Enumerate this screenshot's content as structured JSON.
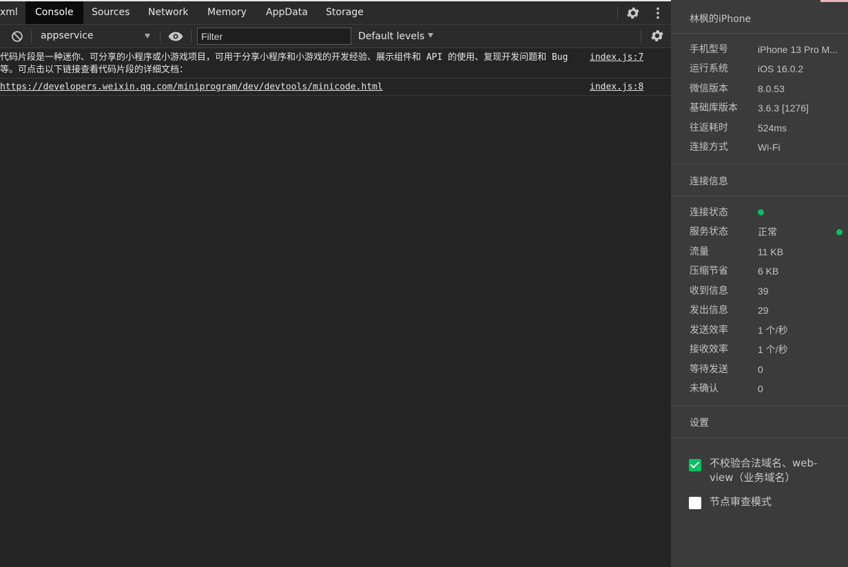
{
  "tabs": [
    {
      "label": "xml",
      "active": false
    },
    {
      "label": "Console",
      "active": true
    },
    {
      "label": "Sources",
      "active": false
    },
    {
      "label": "Network",
      "active": false
    },
    {
      "label": "Memory",
      "active": false
    },
    {
      "label": "AppData",
      "active": false
    },
    {
      "label": "Storage",
      "active": false
    }
  ],
  "toolbar": {
    "context": "appservice",
    "filter_placeholder": "Filter",
    "levels": "Default levels"
  },
  "console": {
    "messages": [
      {
        "text": "代码片段是一种迷你、可分享的小程序或小游戏项目，可用于分享小程序和小游戏的开发经验、展示组件和 API 的使用、复现开发问题和 Bug 等。可点击以下链接查看代码片段的详细文档：",
        "source": "index.js:7"
      },
      {
        "text": "https://developers.weixin.qq.com/miniprogram/dev/devtools/minicode.html",
        "source": "index.js:8"
      }
    ]
  },
  "device": {
    "title": "林枫的iPhone",
    "info": [
      {
        "key": "手机型号",
        "value": "iPhone 13 Pro M..."
      },
      {
        "key": "运行系统",
        "value": "iOS 16.0.2"
      },
      {
        "key": "微信版本",
        "value": "8.0.53"
      },
      {
        "key": "基础库版本",
        "value": "3.6.3 [1276]"
      },
      {
        "key": "往返耗时",
        "value": "524ms"
      },
      {
        "key": "连接方式",
        "value": "Wi-Fi"
      }
    ]
  },
  "connection": {
    "title": "连接信息",
    "rows": [
      {
        "key": "连接状态",
        "value": ""
      },
      {
        "key": "服务状态",
        "value": "正常"
      },
      {
        "key": "流量",
        "value": "11 KB"
      },
      {
        "key": "压缩节省",
        "value": "6 KB"
      },
      {
        "key": "收到信息",
        "value": "39"
      },
      {
        "key": "发出信息",
        "value": "29"
      },
      {
        "key": "发送效率",
        "value": "1 个/秒"
      },
      {
        "key": "接收效率",
        "value": "1 个/秒"
      },
      {
        "key": "等待发送",
        "value": "0"
      },
      {
        "key": "未确认",
        "value": "0"
      }
    ],
    "status_color": "#07c160"
  },
  "settings": {
    "title": "设置",
    "options": [
      {
        "label": "不校验合法域名、web-view（业务域名）",
        "checked": true
      },
      {
        "label": "节点审查模式",
        "checked": false
      }
    ]
  },
  "colors": {
    "accent": "#07c160",
    "console_bg": "#242424",
    "panel_bg": "#3b3b3b"
  }
}
